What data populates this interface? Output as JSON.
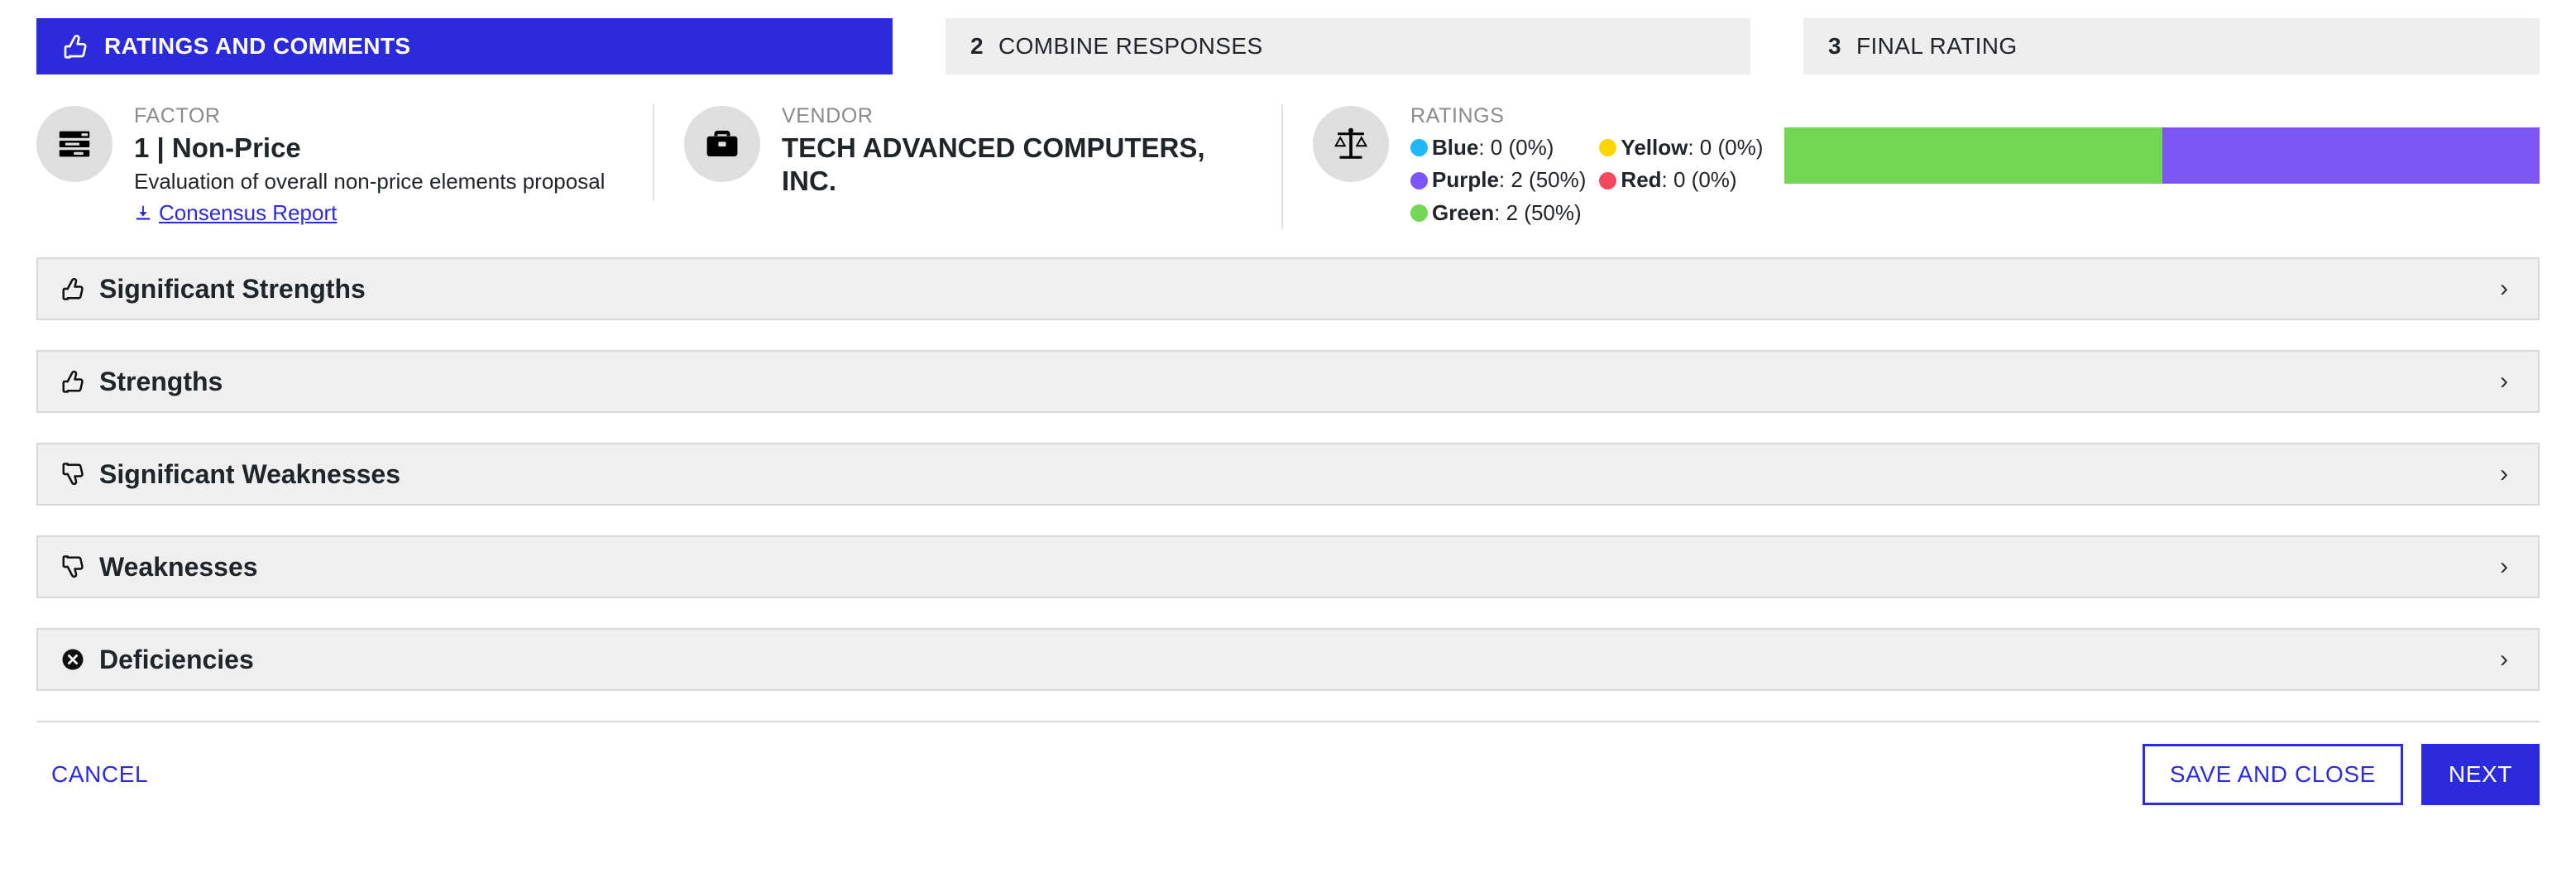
{
  "stepper": {
    "steps": [
      {
        "num": "",
        "label": "Ratings and Comments",
        "icon": "thumbs-up-icon",
        "active": true
      },
      {
        "num": "2",
        "label": "Combine Responses",
        "icon": "",
        "active": false
      },
      {
        "num": "3",
        "label": "Final Rating",
        "icon": "",
        "active": false
      }
    ]
  },
  "summary": {
    "factor": {
      "icon": "list-rows-icon",
      "kicker": "FACTOR",
      "title": "1 | Non-Price",
      "description": "Evaluation of overall non-price elements proposal",
      "link_label": "Consensus Report",
      "link_icon": "download-icon"
    },
    "vendor": {
      "icon": "briefcase-icon",
      "kicker": "VENDOR",
      "title": "TECH ADVANCED COMPUTERS, INC."
    },
    "ratings": {
      "icon": "scales-icon",
      "kicker": "RATINGS",
      "legend_col1": [
        {
          "name": "Blue",
          "value": "0 (0%)",
          "color": "#21b6f5"
        },
        {
          "name": "Purple",
          "value": "2 (50%)",
          "color": "#7b55f5"
        },
        {
          "name": "Green",
          "value": "2 (50%)",
          "color": "#74d655"
        }
      ],
      "legend_col2": [
        {
          "name": "Yellow",
          "value": "0 (0%)",
          "color": "#ffd400"
        },
        {
          "name": "Red",
          "value": "0 (0%)",
          "color": "#f4485e"
        }
      ],
      "bar_segments": [
        {
          "name": "Green",
          "percent": 50,
          "color": "#74d655"
        },
        {
          "name": "Purple",
          "percent": 50,
          "color": "#7b55f5"
        }
      ]
    }
  },
  "accordion": {
    "items": [
      {
        "label": "Significant Strengths",
        "icon": "thumbs-up-icon",
        "chevron": "›"
      },
      {
        "label": "Strengths",
        "icon": "thumbs-up-icon",
        "chevron": "›"
      },
      {
        "label": "Significant Weaknesses",
        "icon": "thumbs-down-icon",
        "chevron": "›"
      },
      {
        "label": "Weaknesses",
        "icon": "thumbs-down-icon",
        "chevron": "›"
      },
      {
        "label": "Deficiencies",
        "icon": "circle-x-icon",
        "chevron": "›"
      }
    ]
  },
  "footer": {
    "cancel_label": "Cancel",
    "save_close_label": "Save and Close",
    "next_label": "Next"
  },
  "colors": {
    "brand_blue": "#2b2bdd",
    "panel_gray": "#efefef",
    "border_gray": "#d8d8d8"
  }
}
